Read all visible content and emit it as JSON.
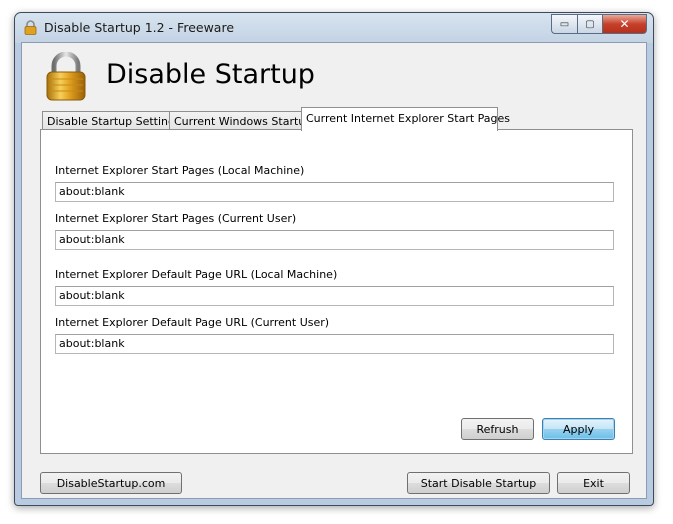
{
  "window": {
    "title": "Disable Startup 1.2 - Freeware",
    "caption_min": "▭",
    "caption_max": "▢",
    "caption_close": "✕"
  },
  "header": {
    "heading": "Disable Startup"
  },
  "tabs": [
    {
      "label": "Disable Startup Settings",
      "active": false
    },
    {
      "label": "Current Windows Startup",
      "active": false
    },
    {
      "label": "Current Internet Explorer Start Pages",
      "active": true
    }
  ],
  "fields": [
    {
      "label": "Internet Explorer Start Pages (Local Machine)",
      "value": "about:blank"
    },
    {
      "label": "Internet Explorer Start Pages (Current User)",
      "value": "about:blank"
    },
    {
      "label": "Internet Explorer Default Page URL (Local Machine)",
      "value": "about:blank"
    },
    {
      "label": "Internet Explorer Default Page URL (Current User)",
      "value": "about:blank"
    }
  ],
  "panel_buttons": {
    "refresh": "Refrush",
    "apply": "Apply"
  },
  "footer": {
    "website": "DisableStartup.com",
    "start": "Start Disable Startup",
    "exit": "Exit"
  },
  "colors": {
    "accent": "#3c7fb1",
    "frame": "#b9cbe0",
    "close": "#c6412b",
    "lock_gold": "#e0a020"
  },
  "icons": {
    "title": "padlock-icon",
    "logo": "padlock-icon"
  }
}
